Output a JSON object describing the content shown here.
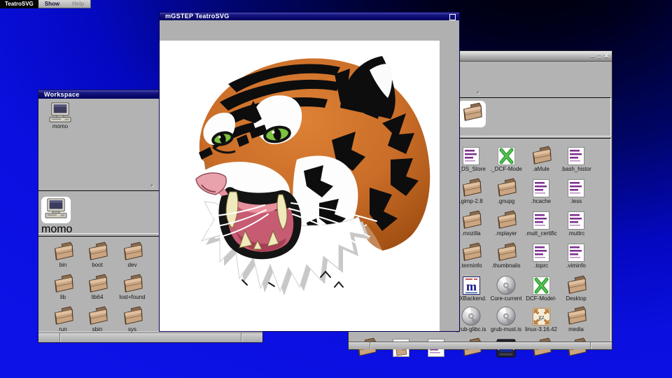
{
  "colors": {
    "desktop_blue": "#0b10e0",
    "desktop_dark_corner": "#000000",
    "titlebar_navy": "#000060",
    "window_gray": "#b3b3b3",
    "folder_tan": "#c9a583",
    "tiger_orange": "#c96d28",
    "tiger_eye_green": "#7cc13f",
    "tiger_mouth_rose": "#c65b72"
  },
  "menu_bar": {
    "app_label": "TeatroSVG",
    "items": [
      {
        "label": "Show",
        "enabled": true
      },
      {
        "label": "Help",
        "enabled": false
      }
    ]
  },
  "svg_window": {
    "title": "mGSTEP TeatroSVG",
    "close_glyph": "",
    "image": "tiger-head-svg-drawing"
  },
  "workspace_window": {
    "title": "Workspace",
    "top_icon": {
      "label": "momo",
      "type": "computer"
    },
    "shelf_icon": {
      "label": "momo",
      "type": "computer",
      "highlighted": true
    },
    "items": [
      {
        "label": "bin",
        "type": "folder",
        "col": 1,
        "row": 1
      },
      {
        "label": "boot",
        "type": "folder",
        "col": 2,
        "row": 1
      },
      {
        "label": "dev",
        "type": "folder",
        "col": 3,
        "row": 1
      },
      {
        "label": "lib",
        "type": "folder",
        "col": 1,
        "row": 2
      },
      {
        "label": "lib64",
        "type": "folder",
        "col": 2,
        "row": 2
      },
      {
        "label": "lost+found",
        "type": "folder",
        "col": 3,
        "row": 2
      },
      {
        "label": "run",
        "type": "folder",
        "col": 1,
        "row": 3
      },
      {
        "label": "sbin",
        "type": "folder",
        "col": 2,
        "row": 3
      },
      {
        "label": "sys",
        "type": "folder",
        "col": 3,
        "row": 3
      },
      {
        "label": "",
        "type": "folder",
        "col": 4,
        "row": 1
      },
      {
        "label": "",
        "type": "folder",
        "col": 4,
        "row": 2
      },
      {
        "label": "",
        "type": "folder",
        "col": 4,
        "row": 3
      }
    ]
  },
  "files_window": {
    "window_buttons": [
      {
        "name": "minimize",
        "glyph": "–"
      },
      {
        "name": "maximize",
        "glyph": "□"
      },
      {
        "name": "close",
        "glyph": "✕"
      }
    ],
    "shelf_icon": {
      "label": "",
      "type": "folder",
      "highlighted": true
    },
    "items": [
      {
        "label": "._DS_Store",
        "type": "doc",
        "col": 4,
        "row": 1
      },
      {
        "label": "._DCF-Mode",
        "type": "xdoc",
        "col": 5,
        "row": 1
      },
      {
        "label": ".aMule",
        "type": "folder",
        "col": 6,
        "row": 1
      },
      {
        "label": ".bash_histor",
        "type": "doc",
        "col": 7,
        "row": 1
      },
      {
        "label": ".gimp-2.8",
        "type": "folder",
        "col": 4,
        "row": 2
      },
      {
        "label": ".gnupg",
        "type": "folder",
        "col": 5,
        "row": 2
      },
      {
        "label": ".hcache",
        "type": "doc",
        "col": 6,
        "row": 2
      },
      {
        "label": ".less",
        "type": "doc",
        "col": 7,
        "row": 2
      },
      {
        "label": ".mozilla",
        "type": "folder",
        "col": 4,
        "row": 3
      },
      {
        "label": ".mplayer",
        "type": "folder",
        "col": 5,
        "row": 3
      },
      {
        "label": ".mutt_certific",
        "type": "doc",
        "col": 6,
        "row": 3
      },
      {
        "label": ".muttrc",
        "type": "doc",
        "col": 7,
        "row": 3
      },
      {
        "label": ".terminfo",
        "type": "folder",
        "col": 4,
        "row": 4
      },
      {
        "label": ".thumbnails",
        "type": "folder",
        "col": 5,
        "row": 4
      },
      {
        "label": ".toprc",
        "type": "doc",
        "col": 6,
        "row": 4
      },
      {
        "label": ".viminfo",
        "type": "doc",
        "col": 7,
        "row": 4
      },
      {
        "label": "AXBackend.",
        "type": "mstep",
        "col": 4,
        "row": 5
      },
      {
        "label": "Core-current",
        "type": "cd",
        "col": 5,
        "row": 5
      },
      {
        "label": "DCF-Model-",
        "type": "xdoc",
        "col": 6,
        "row": 5
      },
      {
        "label": "Desktop",
        "type": "folder",
        "col": 7,
        "row": 5
      },
      {
        "label": "grub-glibc.is",
        "type": "cd",
        "col": 4,
        "row": 6
      },
      {
        "label": "grub-must.is",
        "type": "cd",
        "col": 5,
        "row": 6
      },
      {
        "label": "linux-3.16.42",
        "type": "gz",
        "col": 6,
        "row": 6
      },
      {
        "label": "media",
        "type": "folder",
        "col": 7,
        "row": 6
      },
      {
        "label": "",
        "type": "folder",
        "col": 1,
        "row": 7
      },
      {
        "label": "",
        "type": "tar",
        "col": 2,
        "row": 7
      },
      {
        "label": "",
        "type": "doc",
        "col": 3,
        "row": 7
      },
      {
        "label": "",
        "type": "folder",
        "col": 4,
        "row": 7
      },
      {
        "label": "",
        "type": "unix",
        "col": 5,
        "row": 7
      },
      {
        "label": "",
        "type": "folder",
        "col": 6,
        "row": 7
      },
      {
        "label": "",
        "type": "folder",
        "col": 7,
        "row": 7
      }
    ]
  }
}
